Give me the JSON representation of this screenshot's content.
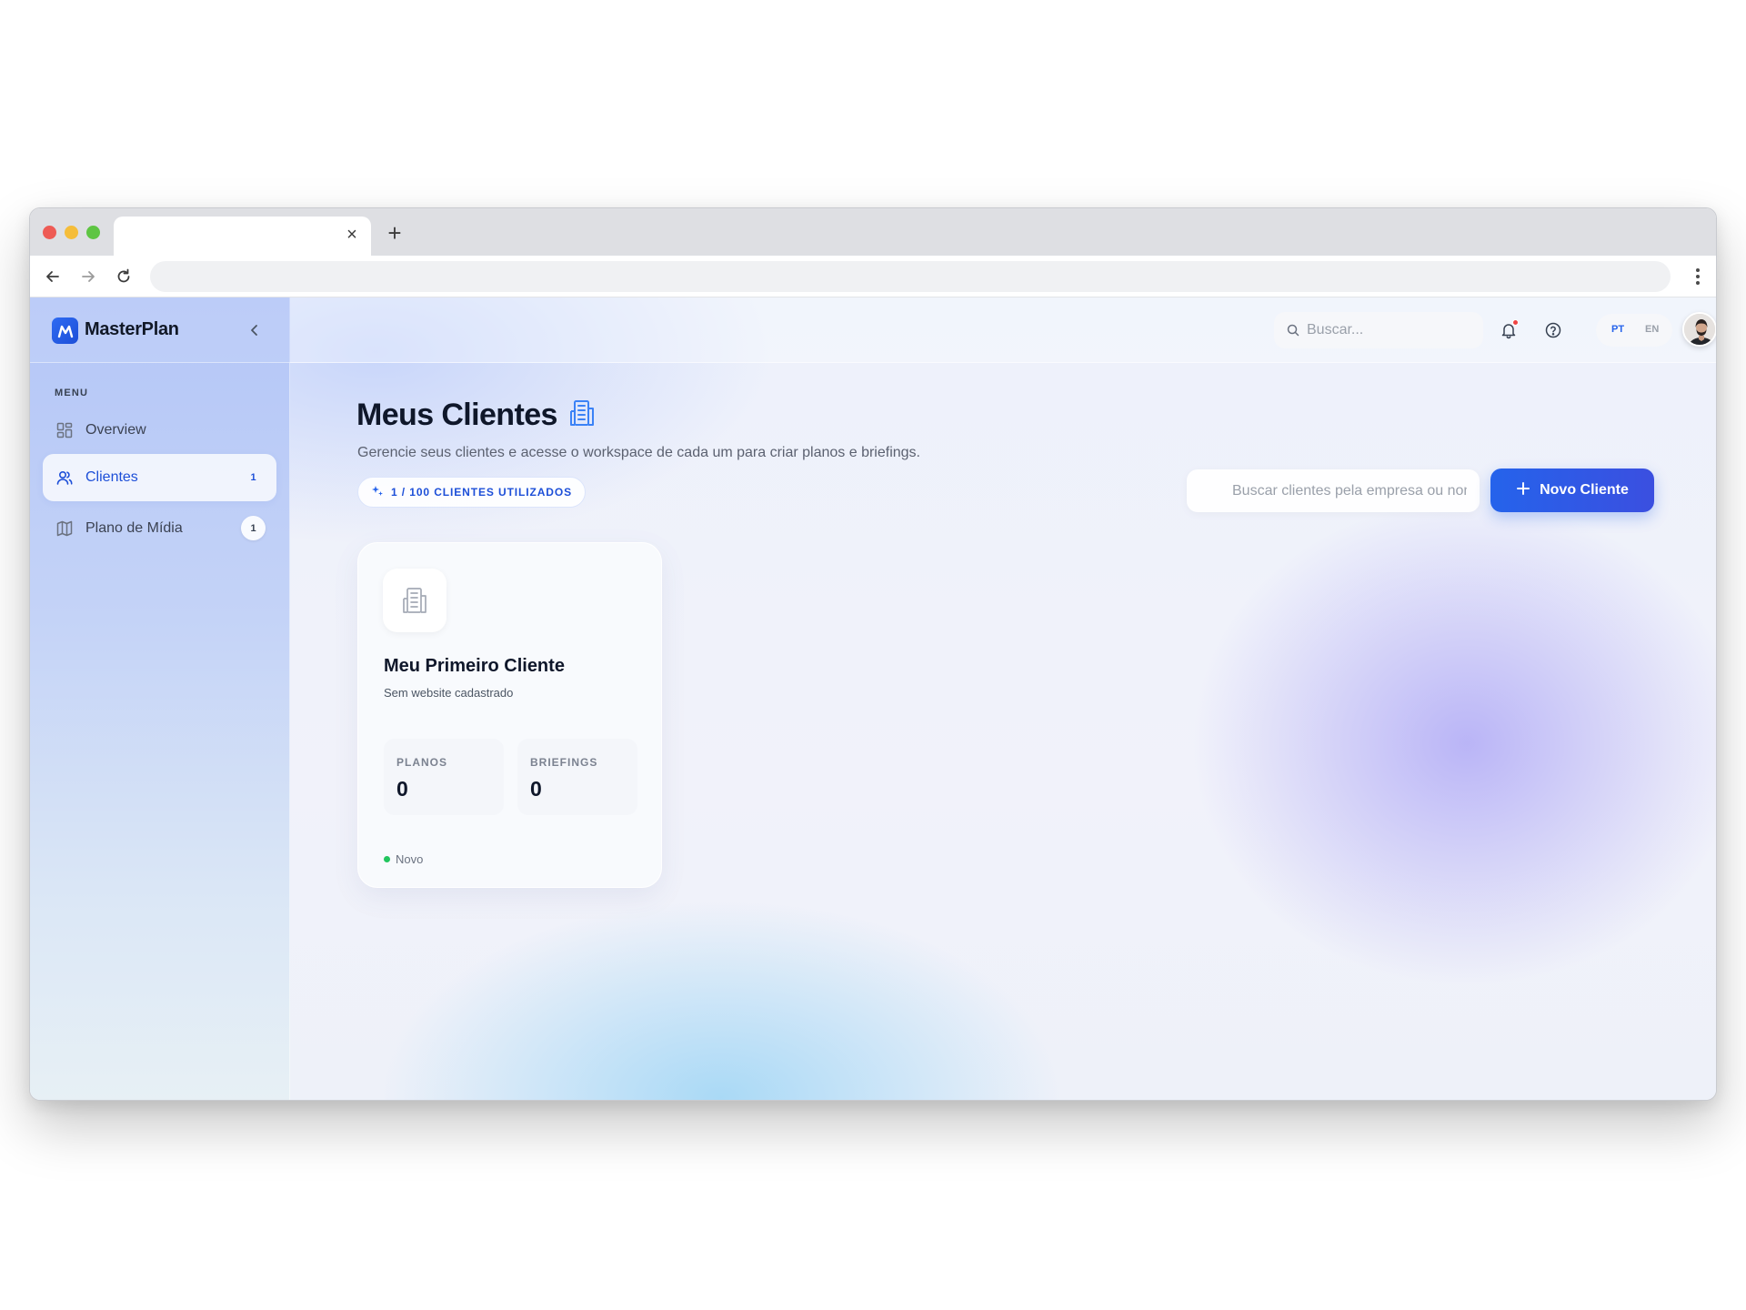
{
  "browser": {
    "tab_title": "",
    "url": "",
    "tab_close_glyph": "×",
    "new_tab_glyph": "+"
  },
  "app": {
    "brand": "MasterPlan",
    "brand_color": "#2563eb"
  },
  "sidebar": {
    "menu_title": "MENU",
    "items": [
      {
        "label": "Overview",
        "icon": "grid-icon",
        "badge": ""
      },
      {
        "label": "Clientes",
        "icon": "users-icon",
        "badge": "1",
        "active": true
      },
      {
        "label": "Plano de Mídia",
        "icon": "map-icon",
        "badge": "1"
      }
    ]
  },
  "topbar": {
    "search_placeholder": "Buscar...",
    "has_notification": true,
    "languages": [
      "PT",
      "EN"
    ],
    "active_language": "PT"
  },
  "main": {
    "title": "Meus Clientes",
    "subtitle": "Gerencie seus clientes e acesse o workspace de cada um para criar planos e briefings.",
    "usage_badge": "1 / 100 CLIENTES UTILIZADOS",
    "client_search_placeholder": "Buscar clientes pela empresa ou nome",
    "new_client_label": "Novo Cliente"
  },
  "clients": [
    {
      "name": "Meu Primeiro Cliente",
      "website": "Sem website cadastrado",
      "stats": [
        {
          "label": "PLANOS",
          "value": "0"
        },
        {
          "label": "BRIEFINGS",
          "value": "0"
        }
      ],
      "status": "Novo",
      "status_color": "#22c55e"
    }
  ]
}
